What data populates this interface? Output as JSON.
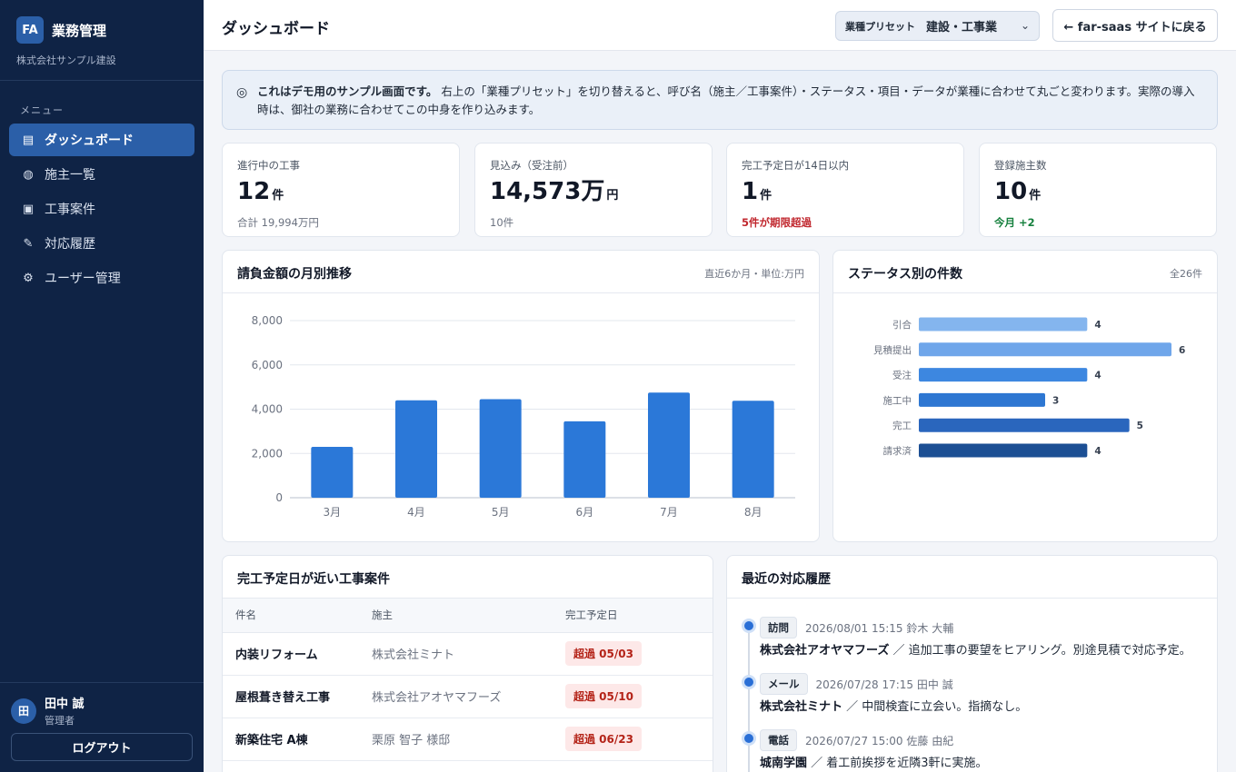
{
  "sidebar": {
    "brand_badge": "FA",
    "brand_name": "業務管理",
    "company": "株式会社サンプル建設",
    "menu_label": "メニュー",
    "items": [
      {
        "label": "ダッシュボード",
        "icon": "dashboard-icon",
        "glyph": "▤",
        "active": true
      },
      {
        "label": "施主一覧",
        "icon": "globe-icon",
        "glyph": "◍",
        "active": false
      },
      {
        "label": "工事案件",
        "icon": "folder-icon",
        "glyph": "▣",
        "active": false
      },
      {
        "label": "対応履歴",
        "icon": "pencil-icon",
        "glyph": "✎",
        "active": false
      },
      {
        "label": "ユーザー管理",
        "icon": "gear-icon",
        "glyph": "⚙",
        "active": false
      }
    ],
    "user": {
      "avatar": "田",
      "name": "田中 誠",
      "role": "管理者"
    },
    "logout_label": "ログアウト"
  },
  "header": {
    "title": "ダッシュボード",
    "preset_label": "業種プリセット",
    "preset_value": "建設・工事業",
    "back_label": "← far-saas サイトに戻る"
  },
  "notice": {
    "strong": "これはデモ用のサンプル画面です。",
    "text": "右上の「業種プリセット」を切り替えると、呼び名（施主／工事案件）・ステータス・項目・データが業種に合わせて丸ごと変わります。実際の導入時は、御社の業務に合わせてこの中身を作り込みます。"
  },
  "kpis": [
    {
      "label": "進行中の工事",
      "value": "12",
      "unit": "件",
      "sub": "合計 19,994万円",
      "sub_style": ""
    },
    {
      "label": "見込み（受注前）",
      "value": "14,573万",
      "unit": "円",
      "sub": "10件",
      "sub_style": ""
    },
    {
      "label": "完工予定日が14日以内",
      "value": "1",
      "unit": "件",
      "sub": "5件が期限超過",
      "sub_style": "red"
    },
    {
      "label": "登録施主数",
      "value": "10",
      "unit": "件",
      "sub": "今月 +2",
      "sub_style": "green"
    }
  ],
  "monthly_panel": {
    "title": "請負金額の月別推移",
    "meta": "直近6か月・単位:万円"
  },
  "status_panel": {
    "title": "ステータス別の件数",
    "meta": "全26件"
  },
  "chart_data": [
    {
      "type": "bar",
      "categories": [
        "3月",
        "4月",
        "5月",
        "6月",
        "7月",
        "8月"
      ],
      "values": [
        2300,
        4400,
        4450,
        3450,
        4750,
        4380
      ],
      "ylim": [
        0,
        8000
      ],
      "yticks": [
        "0",
        "2,000",
        "4,000",
        "6,000",
        "8,000"
      ],
      "ytick_values": [
        0,
        2000,
        4000,
        6000,
        8000
      ],
      "grid": true,
      "color": "#2b78d8"
    },
    {
      "type": "bar",
      "orientation": "horizontal",
      "categories": [
        "引合",
        "見積提出",
        "受注",
        "施工中",
        "完工",
        "請求済"
      ],
      "values": [
        4,
        6,
        4,
        3,
        5,
        4
      ],
      "xlim": [
        0,
        6
      ],
      "colors": [
        "#84b5ee",
        "#6fa6ea",
        "#3d87e0",
        "#2e77d2",
        "#2a66bd",
        "#1c4f94"
      ]
    }
  ],
  "deadline_panel": {
    "title": "完工予定日が近い工事案件",
    "columns": [
      "件名",
      "施主",
      "完工予定日"
    ],
    "rows": [
      {
        "name": "内装リフォーム",
        "client": "株式会社ミナト",
        "date": "超過 05/03"
      },
      {
        "name": "屋根葺き替え工事",
        "client": "株式会社アオヤマフーズ",
        "date": "超過 05/10"
      },
      {
        "name": "新築住宅 A棟",
        "client": "栗原 智子 様邸",
        "date": "超過 06/23"
      }
    ]
  },
  "history_panel": {
    "title": "最近の対応履歴",
    "items": [
      {
        "tag": "訪問",
        "meta": "2026/08/01 15:15  鈴木 大輔",
        "who": "株式会社アオヤマフーズ",
        "text": "／ 追加工事の要望をヒアリング。別途見積で対応予定。"
      },
      {
        "tag": "メール",
        "meta": "2026/07/28 17:15  田中 誠",
        "who": "株式会社ミナト",
        "text": "／ 中間検査に立会い。指摘なし。"
      },
      {
        "tag": "電話",
        "meta": "2026/07/27 15:00  佐藤 由紀",
        "who": "城南学園",
        "text": "／ 着工前挨拶を近隣3軒に実施。"
      }
    ]
  }
}
